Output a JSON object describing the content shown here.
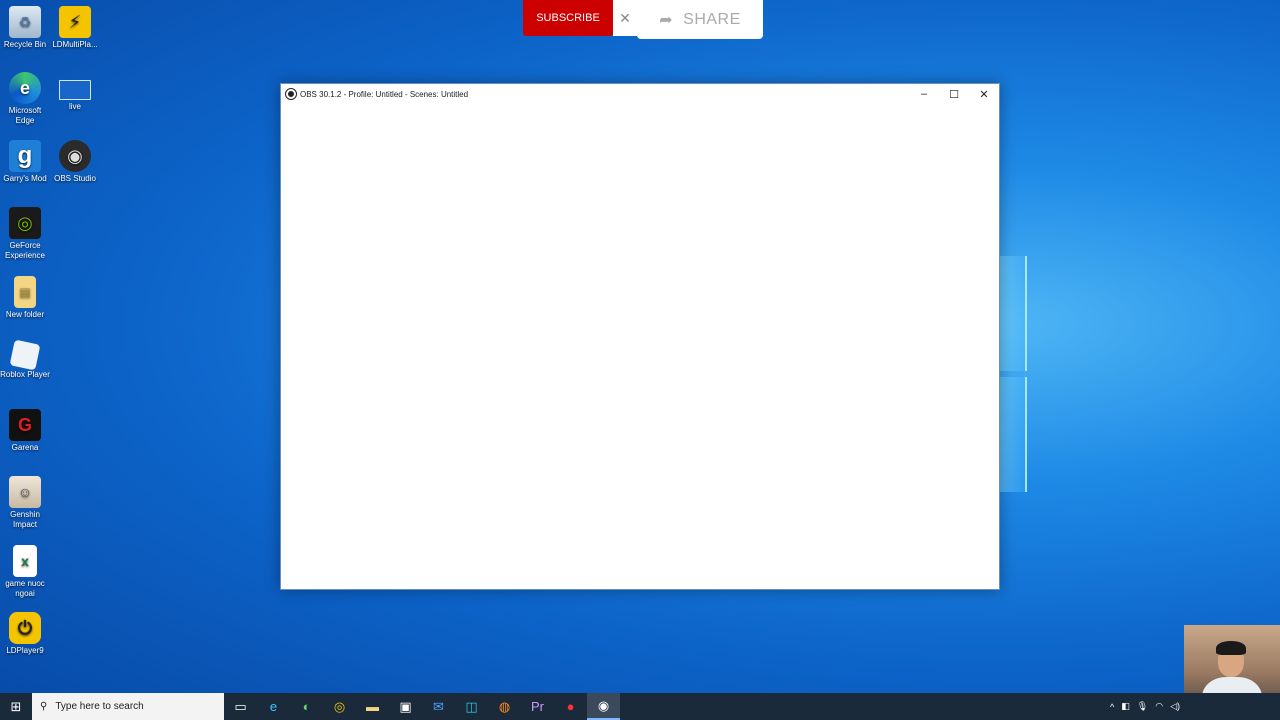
{
  "desktop": {
    "icons": [
      {
        "label": "Recycle Bin",
        "icon": "recycle-bin-icon"
      },
      {
        "label": "LDMultiPla...",
        "icon": "ldmultiplayer-icon"
      },
      {
        "label": "Microsoft Edge",
        "icon": "edge-icon"
      },
      {
        "label": "live",
        "icon": "monitor-icon"
      },
      {
        "label": "Garry's Mod",
        "icon": "garrys-mod-icon"
      },
      {
        "label": "OBS Studio",
        "icon": "obs-icon"
      },
      {
        "label": "GeForce Experience",
        "icon": "geforce-icon"
      },
      {
        "label": "New folder",
        "icon": "folder-icon"
      },
      {
        "label": "Roblox Player",
        "icon": "roblox-icon"
      },
      {
        "label": "Garena",
        "icon": "garena-icon"
      },
      {
        "label": "Genshin Impact",
        "icon": "genshin-icon"
      },
      {
        "label": "game nuoc ngoai",
        "icon": "excel-icon"
      },
      {
        "label": "LDPlayer9",
        "icon": "ldplayer-icon"
      }
    ]
  },
  "overlay": {
    "subscribe_label": "SUBSCRIBE",
    "close_glyph": "✕",
    "share_label": "SHARE"
  },
  "window": {
    "title": "OBS 30.1.2 - Profile: Untitled - Scenes: Untitled",
    "minimize": "–",
    "maximize": "☐",
    "close": "✕"
  },
  "taskbar": {
    "search_placeholder": "Type here to search",
    "apps": [
      "task-view",
      "edge",
      "app-green",
      "chrome",
      "file-explorer",
      "store",
      "mail",
      "app-teal",
      "firefox",
      "premiere",
      "recorder",
      "obs"
    ]
  },
  "colors": {
    "subscribe": "#cc0000",
    "taskbar": "#1b2a3a",
    "desktop_accent": "#1e8ae6"
  }
}
